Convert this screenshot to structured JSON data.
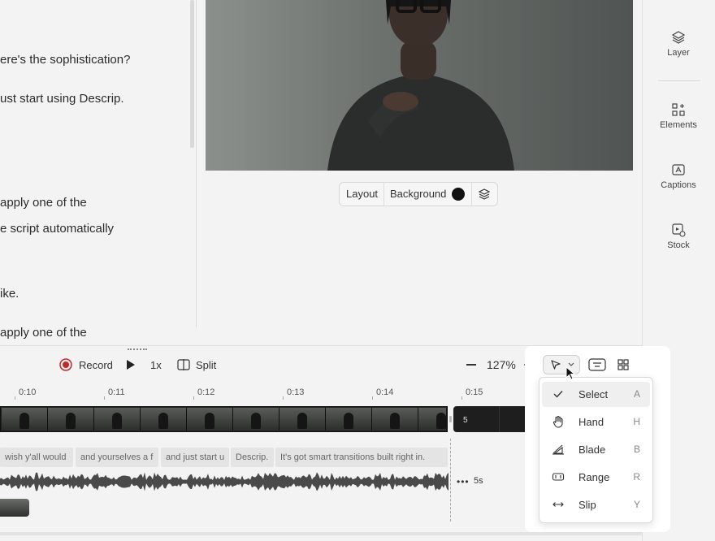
{
  "script": {
    "lines": [
      "ere's the sophistication?",
      "ust start using Descrip.",
      " apply one of the",
      "e script automatically",
      "ike.",
      "apply one of the"
    ]
  },
  "preview": {
    "toolbar": {
      "layout_label": "Layout",
      "background_label": "Background",
      "background_color": "#111111"
    }
  },
  "right_rail": {
    "items": [
      {
        "label": "Layer",
        "icon": "layers-icon"
      },
      {
        "label": "Elements",
        "icon": "elements-icon"
      },
      {
        "label": "Captions",
        "icon": "captions-icon"
      },
      {
        "label": "Stock",
        "icon": "stock-icon"
      }
    ]
  },
  "timeline": {
    "record_label": "Record",
    "speed_label": "1x",
    "split_label": "Split",
    "zoom_level": "127%",
    "ruler_labels": [
      "0:10",
      "0:11",
      "0:12",
      "0:13",
      "0:14",
      "0:15"
    ],
    "gap_label": "5",
    "gap_duration": "5s",
    "captions": [
      "wish y'all would",
      "and yourselves a f",
      "and just start u",
      "Descrip.",
      "It's got smart transitions built right in."
    ]
  },
  "tool_menu": {
    "items": [
      {
        "label": "Select",
        "key": "A",
        "icon": "check-icon",
        "selected": true
      },
      {
        "label": "Hand",
        "key": "H",
        "icon": "hand-icon",
        "selected": false
      },
      {
        "label": "Blade",
        "key": "B",
        "icon": "blade-icon",
        "selected": false
      },
      {
        "label": "Range",
        "key": "R",
        "icon": "range-icon",
        "selected": false
      },
      {
        "label": "Slip",
        "key": "Y",
        "icon": "slip-icon",
        "selected": false
      }
    ]
  },
  "colors": {
    "record_red": "#c62828",
    "panel_bg": "#ffffff",
    "app_bg": "#f3f3f3"
  }
}
